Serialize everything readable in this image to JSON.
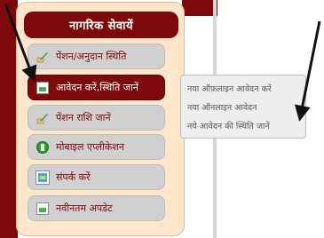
{
  "panel": {
    "title": "नागरिक सेवायें"
  },
  "menu": {
    "items": [
      {
        "label": "पेंशन/अनुदान स्थिति",
        "icon": "pencil-icon"
      },
      {
        "label": "आवेदन करें,स्थिति जानें",
        "icon": "document-icon",
        "active": true
      },
      {
        "label": "पेंशन राशि जानें",
        "icon": "pencil-icon"
      },
      {
        "label": "मोबाइल एप्लीकेशन",
        "icon": "download-circle-icon"
      },
      {
        "label": "संपर्क करें",
        "icon": "contact-screen-icon"
      },
      {
        "label": "नवीनतम अपडेट",
        "icon": "document-icon"
      }
    ]
  },
  "submenu": {
    "items": [
      {
        "label": "नया ऑफ़लाइन आवेदन करें"
      },
      {
        "label": "नया ऑनलाइन आवेदन"
      },
      {
        "label": "नये आवेदन की स्थिति जानें"
      }
    ]
  },
  "colors": {
    "brand": "#7d0a0a",
    "panel_bg": "#fde6cc",
    "item_bg": "#d0d0d0",
    "submenu_bg": "#eeeeee",
    "arrow": "#111111"
  }
}
